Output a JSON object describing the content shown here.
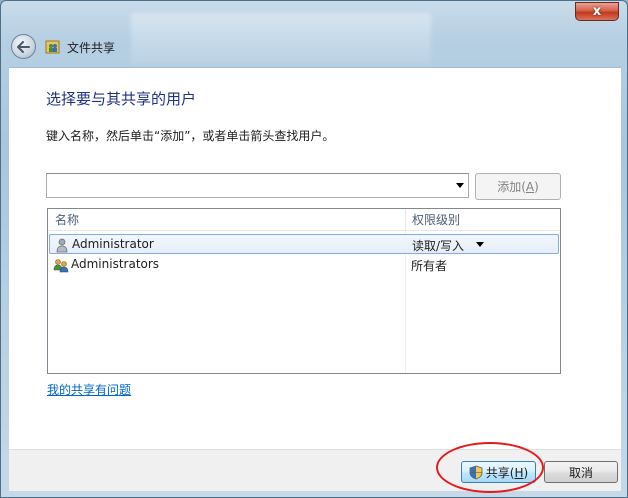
{
  "window": {
    "title": "文件共享",
    "close_glyph": "x"
  },
  "main": {
    "heading": "选择要与其共享的用户",
    "instruction": "键入名称，然后单击“添加”，或者单击箭头查找用户。",
    "name_input": {
      "value": "",
      "placeholder": ""
    },
    "add_button": {
      "label": "添加(",
      "mnemonic": "A",
      "label_end": ")",
      "enabled": false
    }
  },
  "table": {
    "columns": [
      "名称",
      "权限级别"
    ],
    "rows": [
      {
        "name": "Administrator",
        "permission": "读取/写入",
        "icon": "user-icon",
        "selected": true,
        "has_dropdown": true
      },
      {
        "name": "Administrators",
        "permission": "所有者",
        "icon": "group-users-icon",
        "selected": false,
        "has_dropdown": false
      }
    ]
  },
  "link": {
    "text": "我的共享有问题"
  },
  "footer": {
    "share_button": {
      "label": "共享(",
      "mnemonic": "H",
      "label_end": ")",
      "icon": "uac-shield-icon"
    },
    "cancel_button": {
      "label": "取消"
    }
  },
  "colors": {
    "heading": "#1e3287",
    "link": "#0066cc",
    "highlight_ellipse": "#e31b1b",
    "close_button": "#c2391d"
  }
}
